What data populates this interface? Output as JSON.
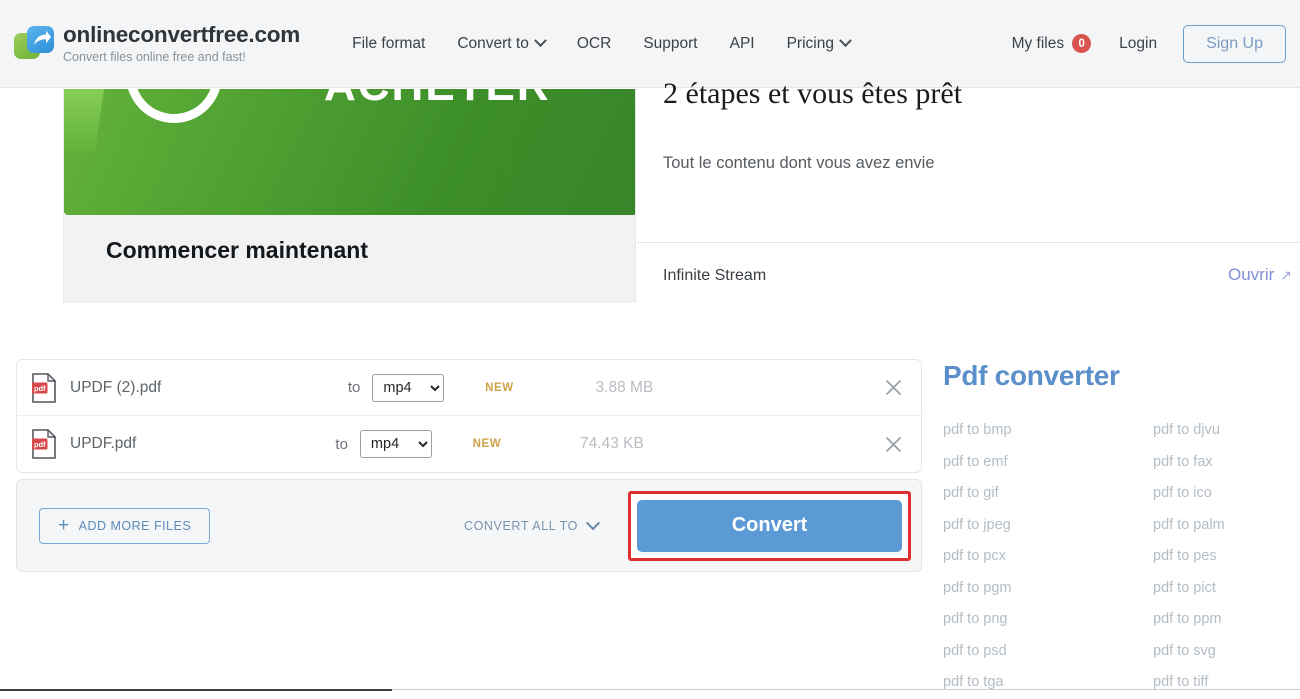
{
  "header": {
    "brand_title": "onlineconvertfree.com",
    "brand_subtitle": "Convert files online free and fast!",
    "logo_icon": "convert-arrow-logo",
    "nav": [
      {
        "label": "File format",
        "has_caret": false
      },
      {
        "label": "Convert to",
        "has_caret": true
      },
      {
        "label": "OCR",
        "has_caret": false
      },
      {
        "label": "Support",
        "has_caret": false
      },
      {
        "label": "API",
        "has_caret": false
      },
      {
        "label": "Pricing",
        "has_caret": true
      }
    ],
    "my_files_label": "My files",
    "my_files_count": "0",
    "login_label": "Login",
    "signup_label": "Sign Up"
  },
  "ad": {
    "banner_word": "ACHETER",
    "cta": "Commencer maintenant",
    "headline": "2 étapes et vous êtes prêt",
    "description": "Tout le contenu dont vous avez envie",
    "brand": "Infinite Stream",
    "open_label": "Ouvrir",
    "open_ext_icon": "external-link-icon"
  },
  "files": {
    "to_label": "to",
    "new_tag": "NEW",
    "close_icon": "close-icon",
    "file_icon": "pdf-file-icon",
    "format_options": [
      "mp4"
    ],
    "rows": [
      {
        "name": "UPDF (2).pdf",
        "format": "mp4",
        "tag": "NEW",
        "size": "3.88 MB"
      },
      {
        "name": "UPDF.pdf",
        "format": "mp4",
        "tag": "NEW",
        "size": "74.43 KB"
      }
    ]
  },
  "convert_bar": {
    "add_more_label": "ADD MORE FILES",
    "add_more_icon": "plus-icon",
    "convert_all_label": "CONVERT ALL TO",
    "convert_all_icon": "chevron-down-icon",
    "convert_label": "Convert",
    "highlight_color": "#e02f2f",
    "button_color": "#5c9ad5"
  },
  "sidebar": {
    "title": "Pdf converter",
    "title_color": "#5b8fc9",
    "links": [
      "pdf to bmp",
      "pdf to djvu",
      "pdf to emf",
      "pdf to fax",
      "pdf to gif",
      "pdf to ico",
      "pdf to jpeg",
      "pdf to palm",
      "pdf to pcx",
      "pdf to pes",
      "pdf to pgm",
      "pdf to pict",
      "pdf to png",
      "pdf to ppm",
      "pdf to psd",
      "pdf to svg",
      "pdf to tga",
      "pdf to tiff"
    ]
  }
}
